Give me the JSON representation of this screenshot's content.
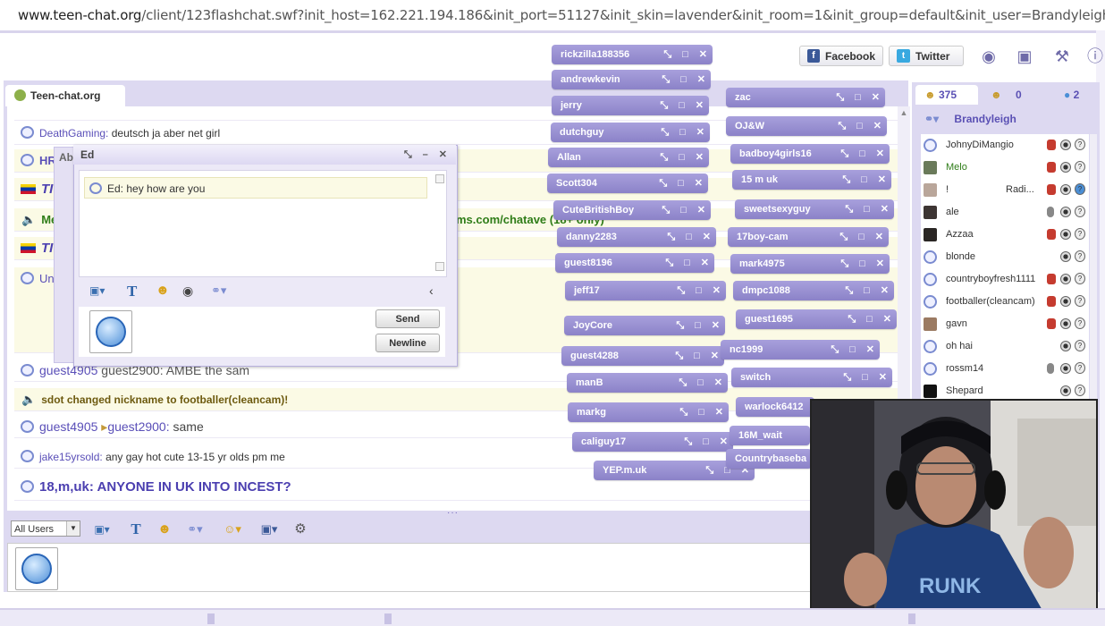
{
  "browser": {
    "url_domain": "www.teen-chat.org",
    "url_rest": "/client/123flashchat.swf?init_host=162.221.194.186&init_port=51127&init_skin=lavender&init_room=1&init_group=default&init_user=Brandyleigh&init_p"
  },
  "header": {
    "facebook_label": "Facebook",
    "twitter_label": "Twitter"
  },
  "room_tab": {
    "label": "Teen-chat.org"
  },
  "messages": [
    {
      "user": "DeathGaming:",
      "text": "deutsch ja aber net girl"
    },
    {
      "user": "HR",
      "text": ""
    },
    {
      "user": "TI",
      "text": ""
    },
    {
      "user": "Me",
      "text": "ms.com/chatave (18+ only)"
    },
    {
      "user": "TI",
      "text": ""
    },
    {
      "user": "Unk",
      "text": ""
    },
    {
      "user": "guest4905",
      "text": "guest2900: AMBE the sam"
    },
    {
      "user": "",
      "text": "sdot changed nickname to footballer(cleancam)!"
    },
    {
      "user": "guest4905",
      "to": "guest2900:",
      "text": "same"
    },
    {
      "user": "jake15yrsold:",
      "text": "any gay hot cute 13-15 yr olds pm me"
    },
    {
      "user": "18,m,uk:",
      "text": "ANYONE IN UK INTO INCEST?"
    }
  ],
  "toolbar": {
    "user_filter": "All Users"
  },
  "user_panel": {
    "tab_users_count": "375",
    "tab_rooms_count": "0",
    "tab_messages_count": "2",
    "current_user": "Brandyleigh",
    "users": [
      {
        "name": "JohnyDiMangio"
      },
      {
        "name": "Melo"
      },
      {
        "name": "!",
        "extra": "Radi..."
      },
      {
        "name": "ale"
      },
      {
        "name": "Azzaa"
      },
      {
        "name": "blonde"
      },
      {
        "name": "countryboyfresh1111"
      },
      {
        "name": "footballer(cleancam)"
      },
      {
        "name": "gavn"
      },
      {
        "name": "oh hai"
      },
      {
        "name": "rossm14"
      },
      {
        "name": "Shepard"
      }
    ]
  },
  "pm_windows": [
    "rickzilla188356",
    "andrewkevin",
    "jerry",
    "dutchguy",
    "Allan",
    "Scott304",
    "CuteBritishBoy",
    "danny2283",
    "guest8196",
    "jeff17",
    "JoyCore",
    "guest4288",
    "manB",
    "markg",
    "caliguy17",
    "YEP.m.uk",
    "zac",
    "OJ&W",
    "badboy4girls16",
    "15 m uk",
    "sweetsexyguy",
    "17boy-cam",
    "mark4975",
    "dmpc1088",
    "guest1695",
    "nc1999",
    "switch",
    "warlock6412",
    "16M_wait",
    "Countrybaseba"
  ],
  "ed_dialog": {
    "title": "Ed",
    "shadow_title": "Ab",
    "message": "Ed: hey how are you",
    "send_label": "Send",
    "newline_label": "Newline"
  },
  "colors": {
    "accent": "#8b82c8",
    "panel": "#ddd9f1",
    "username": "#5a4fb8"
  }
}
